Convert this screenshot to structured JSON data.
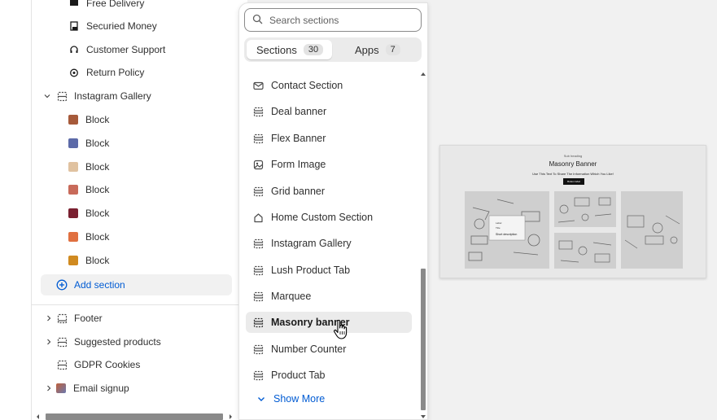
{
  "tree": {
    "top_items": [
      {
        "label": "Free Delivery",
        "icon": "truck-icon"
      },
      {
        "label": "Securied Money",
        "icon": "money-icon"
      },
      {
        "label": "Customer Support",
        "icon": "headset-icon"
      },
      {
        "label": "Return Policy",
        "icon": "return-icon"
      }
    ],
    "instagram_gallery": {
      "label": "Instagram Gallery",
      "icon": "section-icon",
      "expanded": true
    },
    "blocks": [
      {
        "label": "Block",
        "thumb_color": "#a65a3a"
      },
      {
        "label": "Block",
        "thumb_color": "#5c6aa8"
      },
      {
        "label": "Block",
        "thumb_color": "#e0c2a0"
      },
      {
        "label": "Block",
        "thumb_color": "#c86a5a"
      },
      {
        "label": "Block",
        "thumb_color": "#7a2030"
      },
      {
        "label": "Block",
        "thumb_color": "#e07040"
      },
      {
        "label": "Block",
        "thumb_color": "#d08a20"
      }
    ],
    "add_section": "Add section",
    "footer_groups": [
      {
        "label": "Footer",
        "expandable": true,
        "icon": "section-icon"
      },
      {
        "label": "Suggested products",
        "expandable": true,
        "icon": "section-icon"
      },
      {
        "label": "GDPR Cookies",
        "expandable": false,
        "icon": "section-icon"
      },
      {
        "label": "Email signup",
        "expandable": true,
        "icon": "image-thumb-icon"
      }
    ]
  },
  "popover": {
    "search": {
      "placeholder": "Search sections",
      "value": ""
    },
    "tabs": [
      {
        "label": "Sections",
        "count": "30",
        "selected": true
      },
      {
        "label": "Apps",
        "count": "7",
        "selected": false
      }
    ],
    "items": [
      {
        "label": "Contact Section",
        "icon": "envelope-icon"
      },
      {
        "label": "Deal banner",
        "icon": "section-icon"
      },
      {
        "label": "Flex Banner",
        "icon": "section-icon"
      },
      {
        "label": "Form Image",
        "icon": "image-icon"
      },
      {
        "label": "Grid banner",
        "icon": "section-icon"
      },
      {
        "label": "Home Custom Section",
        "icon": "home-icon"
      },
      {
        "label": "Instagram Gallery",
        "icon": "section-icon"
      },
      {
        "label": "Lush Product Tab",
        "icon": "section-icon"
      },
      {
        "label": "Marquee",
        "icon": "section-icon"
      },
      {
        "label": "Masonry banner",
        "icon": "section-icon",
        "hovered": true
      },
      {
        "label": "Number Counter",
        "icon": "section-icon"
      },
      {
        "label": "Product Tab",
        "icon": "section-icon"
      }
    ],
    "show_more": "Show More"
  },
  "preview": {
    "subheading": "Sub heading",
    "title": "Masonry Banner",
    "description": "Use This Text To Share The Information Which You Like!",
    "button": "Button label",
    "overlay_labels": [
      "Label",
      "Title",
      "Short description"
    ]
  },
  "colors": {
    "accent": "#005bd3",
    "hover_bg": "#ebebeb"
  }
}
